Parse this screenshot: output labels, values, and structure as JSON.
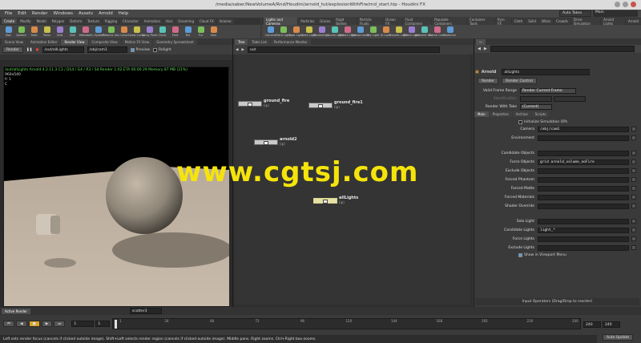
{
  "window": {
    "title": "/media/saber/NewVolumeA/Rnd/Houdini/arnold_tut/explosionWithFire/rnd_start.hip - Houdini FX"
  },
  "menu": [
    "File",
    "Edit",
    "Render",
    "Windows",
    "Assets",
    "Arnold",
    "Help"
  ],
  "toolbar": {
    "auto_takes": "Auto Takes",
    "desktop": "Main"
  },
  "shelf_tabs_left": [
    "Create",
    "Modify",
    "Model",
    "Polygon",
    "Deform",
    "Texture",
    "Rigging",
    "Character",
    "Animation",
    "Hair",
    "Grooming",
    "Cloud FX",
    "Volume"
  ],
  "shelf_tabs_right": [
    "Lights and Cameras",
    "Particles",
    "Grains",
    "Rigid Bodies",
    "Particle Fluids",
    "Ocean FX",
    "Fluid Containers",
    "Populate Containers",
    "Container Tools",
    "Pyro FX",
    "Cloth",
    "Solid",
    "Wires",
    "Crowds",
    "Drive Simulation",
    "Arnold Lights",
    "Arnold"
  ],
  "tools_left": [
    "Box",
    "Sphere",
    "Tube",
    "Torus",
    "Grid",
    "Null",
    "Metaball",
    "L-System",
    "Platonic Sol.",
    "Curve",
    "Draw Curve",
    "Spray Paint",
    "Circle",
    "Font",
    "File",
    "Fur",
    "Hair"
  ],
  "tools_right": [
    "Camera",
    "Point Light",
    "Spot Light",
    "Area Light",
    "Geometry L.",
    "Volume Light",
    "Distant Light",
    "Environment",
    "Sky Light",
    "GI Light",
    "Caustic Light",
    "Portal Light",
    "Ambient Occ.",
    "Stereo Cam.",
    "Switcher"
  ],
  "left_pane": {
    "tabs": [
      "Scene View",
      "Animation Editor",
      "Render View",
      "Composite View",
      "Motion FX View",
      "Geometry Spreadsheet"
    ],
    "render_button": "Render",
    "rop_path": "/out/allLights",
    "camera_path": "/obj/cam1",
    "preview_label": "Preview",
    "relight_label": "Relight",
    "info_line1": "/out/allLights   Arnold 4.2.11.3   C3 / D14 / G4 / R3 / S4   Render 1:02   ETA 00:00 29   Memory 87 MB   (21%)",
    "info_line2": "960x540",
    "info_line3": "fr 1",
    "info_line4": "C",
    "bottom_tab": "Active Render",
    "object_field": "scatter3"
  },
  "net_pane": {
    "tabs": [
      "Tree",
      "Table List",
      "Performance Monitor"
    ],
    "path": "out",
    "nodes": [
      {
        "name": "ground_fire",
        "sub": "(ip)"
      },
      {
        "name": "ground_fire1",
        "sub": "(ip)"
      },
      {
        "name": "arnold2",
        "sub": "(ip)"
      },
      {
        "name": "allLights",
        "sub": "(ip)"
      }
    ]
  },
  "parm_pane": {
    "header_type": "Arnold",
    "header_name": "allLights",
    "render_button": "Render",
    "render_control_button": "Render Control",
    "valid_frame_range_label": "Valid Frame Range",
    "valid_frame_range_value": "Render Current Frame",
    "start_end_inc_label": "Start/End/Inc",
    "render_with_take_label": "Render With Take",
    "render_with_take_value": "(Current)",
    "tabs": [
      "Main",
      "Properties",
      "Archive",
      "Scripts"
    ],
    "init_sim_label": "Initialize Simulation OPs",
    "rows": [
      {
        "label": "Camera",
        "value": "/obj/cam1"
      },
      {
        "label": "Environment",
        "value": ""
      },
      {
        "label": "Candidate Objects",
        "value": ""
      },
      {
        "label": "Force Objects",
        "value": "grid arnold_volume_noFire"
      },
      {
        "label": "Exclude Objects",
        "value": ""
      },
      {
        "label": "Forced Phantom",
        "value": ""
      },
      {
        "label": "Forced Matte",
        "value": ""
      },
      {
        "label": "Forced Materials",
        "value": ""
      },
      {
        "label": "Shader Override",
        "value": ""
      },
      {
        "label": "Solo Light",
        "value": ""
      },
      {
        "label": "Candidate Lights",
        "value": "light_*"
      },
      {
        "label": "Force Lights",
        "value": ""
      },
      {
        "label": "Exclude Lights",
        "value": ""
      }
    ],
    "show_viewport_menu_label": "Show in Viewport Menu",
    "input_operators_label": "Input Operators (Drag/Drop to reorder)"
  },
  "timeline": {
    "frame_field": "1",
    "start_field": "1",
    "ticks": [
      "1",
      "24",
      "48",
      "72",
      "96",
      "120",
      "144",
      "168",
      "192",
      "216",
      "240"
    ],
    "end_field": "240",
    "end_field2": "240",
    "auto_update": "Auto Update"
  },
  "statusbar": {
    "text": "Left sets render focus (cancels if clicked outside image). Shift+Left selects render region (cancels if clicked outside image). Middle pans. Right zooms. Ctrl+Right box-zooms."
  },
  "watermark": "www.cgtsj.com",
  "colors": {
    "accent_green": "#66e05b",
    "watermark_yellow": "#f5e40b",
    "selection_yellow": "#e6e0a5"
  }
}
